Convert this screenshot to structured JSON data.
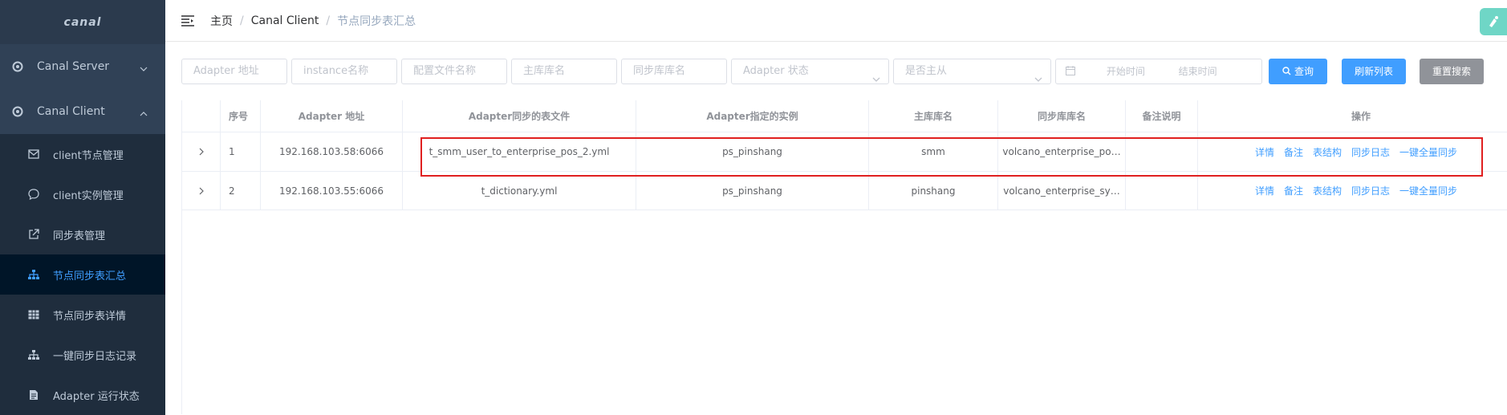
{
  "sidebar": {
    "logo": "canal",
    "menu": [
      {
        "label": "Canal Server",
        "icon": "gear-icon",
        "chevron": "chevron-down-icon"
      },
      {
        "label": "Canal Client",
        "icon": "gear-icon",
        "chevron": "chevron-up-icon"
      }
    ],
    "sub": [
      {
        "label": "client节点管理",
        "icon": "envelope-icon"
      },
      {
        "label": "client实例管理",
        "icon": "chat-icon"
      },
      {
        "label": "同步表管理",
        "icon": "external-link-icon"
      },
      {
        "label": "节点同步表汇总",
        "icon": "hierarchy-icon",
        "active": true
      },
      {
        "label": "节点同步表详情",
        "icon": "grid-icon"
      },
      {
        "label": "一键同步日志记录",
        "icon": "hierarchy-icon"
      },
      {
        "label": "Adapter 运行状态",
        "icon": "document-icon"
      }
    ]
  },
  "breadcrumb": [
    "主页",
    "Canal Client",
    "节点同步表汇总"
  ],
  "filters": {
    "adapter_addr": "Adapter 地址",
    "instance": "instance名称",
    "config_file": "配置文件名称",
    "main_db": "主库库名",
    "sync_db": "同步库库名",
    "adapter_status": "Adapter 状态",
    "is_master_slave": "是否主从",
    "start_time": "开始时间",
    "end_time": "结束时间",
    "query_btn": "查询",
    "refresh_btn": "刷新列表",
    "reset_btn": "重置搜索"
  },
  "table": {
    "headers": [
      "序号",
      "Adapter 地址",
      "Adapter同步的表文件",
      "Adapter指定的实例",
      "主库库名",
      "同步库库名",
      "备注说明",
      "操作"
    ],
    "rows": [
      {
        "idx": "1",
        "addr": "192.168.103.58:6066",
        "file": "t_smm_user_to_enterprise_pos_2.yml",
        "instance": "ps_pinshang",
        "main_db": "smm",
        "sync_db": "volcano_enterprise_po…",
        "remark": ""
      },
      {
        "idx": "2",
        "addr": "192.168.103.55:6066",
        "file": "t_dictionary.yml",
        "instance": "ps_pinshang",
        "main_db": "pinshang",
        "sync_db": "volcano_enterprise_sy…",
        "remark": ""
      }
    ],
    "ops": [
      "详情",
      "备注",
      "表结构",
      "同步日志",
      "一键全量同步"
    ]
  },
  "colors": {
    "sidebar_bg": "#304156",
    "active": "#409eff",
    "primary": "#409eff",
    "reset": "#909399",
    "highlight": "#e02020"
  }
}
